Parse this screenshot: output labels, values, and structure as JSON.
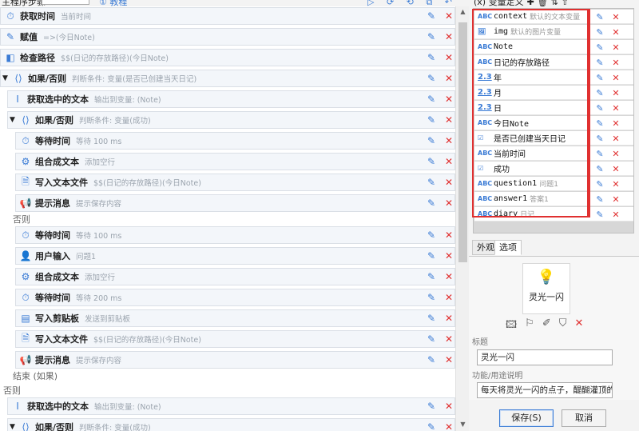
{
  "toolbar": {
    "steps_label": "主程序步骤:",
    "tutorial_link": "① 教程",
    "icons": "▷ ⟳ ⟲ ⧉ ↶ ⊡ ⋯"
  },
  "steps": [
    {
      "icon": "⏱",
      "label": "获取时间",
      "desc": "当前时间"
    },
    {
      "icon": "✎",
      "label": "赋值",
      "desc": "=>(今日Note)"
    },
    {
      "icon": "◧",
      "label": "检查路径",
      "desc": "$$(日记的存放路径)(今日Note)"
    },
    {
      "icon": "⟨⟩",
      "label": "如果/否则",
      "desc": "判断条件: 变量(是否已创建当天日记)"
    },
    {
      "icon": "I",
      "label": "获取选中的文本",
      "desc": "输出到变量: (Note)"
    },
    {
      "icon": "⟨⟩",
      "label": "如果/否则",
      "desc": "判断条件: 变量(成功)"
    },
    {
      "icon": "⏱",
      "label": "等待时间",
      "desc": "等待 100 ms"
    },
    {
      "icon": "⚙",
      "label": "组合成文本",
      "desc": "添加空行"
    },
    {
      "icon": "🗎",
      "label": "写入文本文件",
      "desc": "$$(日记的存放路径)(今日Note)"
    },
    {
      "icon": "📢",
      "label": "提示消息",
      "desc": "提示保存内容"
    },
    {
      "icon": "⏱",
      "label": "等待时间",
      "desc": "等待 100 ms"
    },
    {
      "icon": "👤",
      "label": "用户输入",
      "desc": "问题1"
    },
    {
      "icon": "⚙",
      "label": "组合成文本",
      "desc": "添加空行"
    },
    {
      "icon": "⏱",
      "label": "等待时间",
      "desc": "等待 200 ms"
    },
    {
      "icon": "▤",
      "label": "写入剪贴板",
      "desc": "发送到剪贴板"
    },
    {
      "icon": "🗎",
      "label": "写入文本文件",
      "desc": "$$(日记的存放路径)(今日Note)"
    },
    {
      "icon": "📢",
      "label": "提示消息",
      "desc": "提示保存内容"
    },
    {
      "icon": "I",
      "label": "获取选中的文本",
      "desc": "输出到变量: (Note)"
    },
    {
      "icon": "⟨⟩",
      "label": "如果/否则",
      "desc": "判断条件: 变量(成功)"
    }
  ],
  "structure_labels": {
    "else1": "否则",
    "end_if": "结束 (如果)",
    "else2": "否则"
  },
  "variables_header": {
    "title": "(x) 变量定义",
    "icons": "✚ 🗑 ⇅ ⇧"
  },
  "variables": [
    {
      "type": "ABC",
      "name": "context",
      "desc": "默认的文本变量"
    },
    {
      "type": "🖼",
      "name": "img",
      "desc": "默认的图片变量"
    },
    {
      "type": "ABC",
      "name": "Note",
      "desc": ""
    },
    {
      "type": "ABC",
      "name": "日记的存放路径",
      "desc": ""
    },
    {
      "type": "2.3",
      "name": "年",
      "desc": ""
    },
    {
      "type": "2.3",
      "name": "月",
      "desc": ""
    },
    {
      "type": "2.3",
      "name": "日",
      "desc": ""
    },
    {
      "type": "ABC",
      "name": "今日Note",
      "desc": ""
    },
    {
      "type": "☑",
      "name": "是否已创建当天日记",
      "desc": ""
    },
    {
      "type": "ABC",
      "name": "当前时间",
      "desc": ""
    },
    {
      "type": "☑",
      "name": "成功",
      "desc": ""
    },
    {
      "type": "ABC",
      "name": "question1",
      "desc": "问题1"
    },
    {
      "type": "ABC",
      "name": "answer1",
      "desc": "答案1"
    },
    {
      "type": "ABC",
      "name": "diary",
      "desc": "日记"
    }
  ],
  "tabs": {
    "appearance": "外观",
    "options": "选项"
  },
  "appearance": {
    "card_label": "灵光一闪",
    "title_label": "标题",
    "title_value": "灵光一闪",
    "desc_label": "功能/用途说明",
    "desc_value": "每天将灵光一闪的点子，醍醐灌顶的文"
  },
  "buttons": {
    "save": "保存(S)",
    "cancel": "取消"
  },
  "colors": {
    "accent": "#3a7bd5",
    "danger": "#e03030",
    "highlight": "#e03030"
  }
}
